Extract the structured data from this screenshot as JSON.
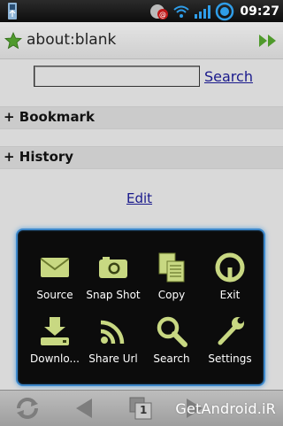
{
  "status_bar": {
    "time": "09:27"
  },
  "browser": {
    "url": "about:blank"
  },
  "page": {
    "search_link": "Search",
    "bookmark_section": "+ Bookmark",
    "history_section": "+ History",
    "edit_link": "Edit"
  },
  "menu": {
    "items": [
      {
        "label": "Source",
        "icon": "envelope-icon"
      },
      {
        "label": "Snap Shot",
        "icon": "camera-icon"
      },
      {
        "label": "Copy",
        "icon": "copy-icon"
      },
      {
        "label": "Exit",
        "icon": "power-icon"
      },
      {
        "label": "Downlo...",
        "icon": "download-icon"
      },
      {
        "label": "Share Url",
        "icon": "rss-icon"
      },
      {
        "label": "Search",
        "icon": "magnifier-icon"
      },
      {
        "label": "Settings",
        "icon": "wrench-icon"
      }
    ]
  },
  "toolbar": {
    "tab_count": "1",
    "watermark": "GetAndroid.iR"
  },
  "colors": {
    "icon_green": "#c8d882",
    "menu_border": "#3d87c9",
    "link": "#1a1a8c"
  }
}
